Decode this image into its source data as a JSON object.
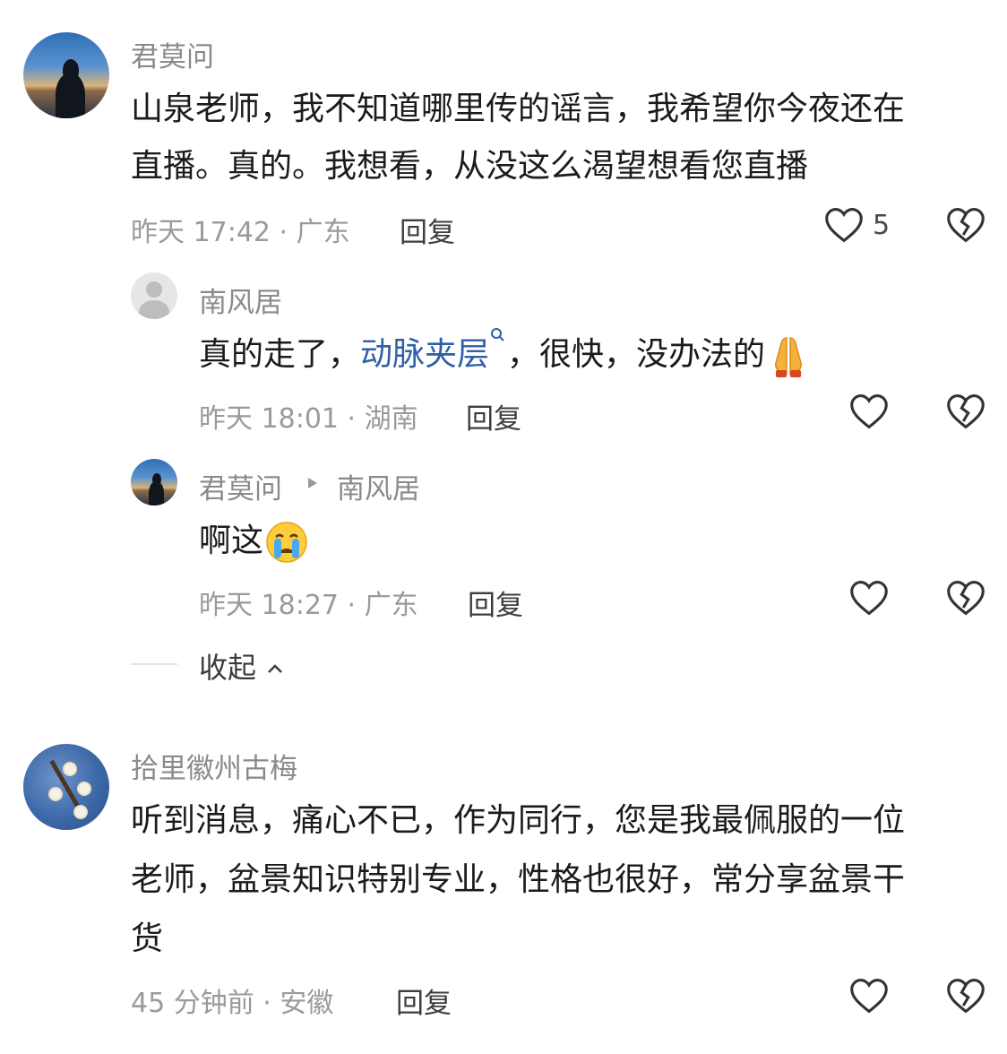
{
  "comments": [
    {
      "username": "君莫问",
      "text_line1": "山泉老师，我不知道哪里传的谣言，我希望你今夜还在",
      "text_line2": "直播。真的。我想看，从没这么渴望想看您直播",
      "meta": "昨天 17:42 · 广东",
      "reply_label": "回复",
      "likes": "5",
      "replies": [
        {
          "username": "南风居",
          "text_before": "真的走了，",
          "text_link": "动脉夹层",
          "text_after": "，很快，没办法的",
          "meta": "昨天 18:01 · 湖南",
          "reply_label": "回复"
        },
        {
          "username": "君莫问",
          "reply_to": "南风居",
          "text": "啊这",
          "meta": "昨天 18:27 · 广东",
          "reply_label": "回复"
        }
      ],
      "collapse_label": "收起"
    },
    {
      "username": "拾里徽州古梅",
      "text_line1": "听到消息，痛心不已，作为同行，您是我最佩服的一位",
      "text_line2": "老师，盆景知识特别专业，性格也很好，常分享盆景干",
      "text_line3": "货",
      "meta": "45 分钟前 · 安徽",
      "reply_label": "回复"
    }
  ],
  "colors": {
    "link": "#2f5fa6",
    "meta": "#9a9a9a",
    "username": "#8a8a8a"
  },
  "icons": [
    "heart-icon",
    "dislike-heart-icon",
    "search-icon",
    "pray-emoji",
    "crying-emoji",
    "chevron-up-icon",
    "triangle-right-icon"
  ]
}
